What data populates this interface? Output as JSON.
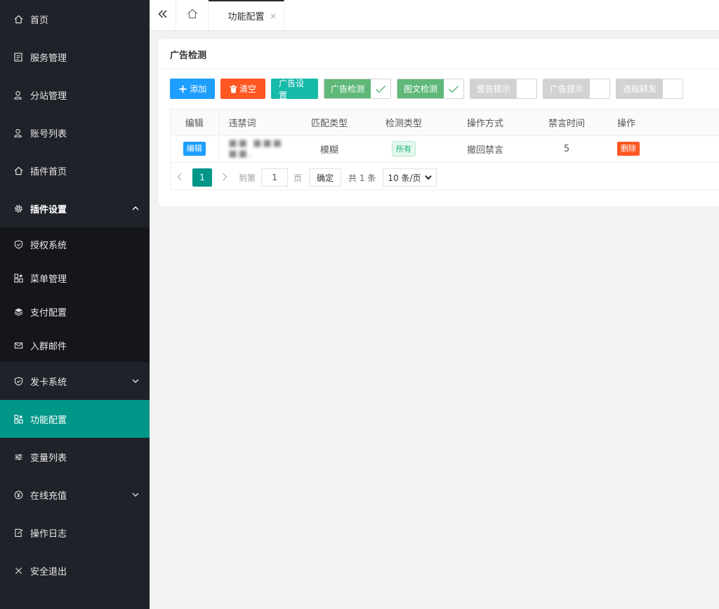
{
  "sidebar": {
    "items": [
      {
        "label": "首页",
        "icon": "home-icon"
      },
      {
        "label": "服务管理",
        "icon": "list-icon"
      },
      {
        "label": "分站管理",
        "icon": "user-icon"
      },
      {
        "label": "账号列表",
        "icon": "user-icon"
      },
      {
        "label": "插件首页",
        "icon": "home-icon"
      },
      {
        "label": "插件设置",
        "icon": "gear-icon"
      },
      {
        "label": "授权系统",
        "icon": "shield-icon"
      },
      {
        "label": "菜单管理",
        "icon": "grid-icon"
      },
      {
        "label": "支付配置",
        "icon": "layers-icon"
      },
      {
        "label": "入群邮件",
        "icon": "mail-icon"
      },
      {
        "label": "发卡系统",
        "icon": "shield-icon"
      },
      {
        "label": "功能配置",
        "icon": "grid-icon"
      },
      {
        "label": "变量列表",
        "icon": "sliders-icon"
      },
      {
        "label": "在线充值",
        "icon": "yen-icon"
      },
      {
        "label": "操作日志",
        "icon": "edit-icon"
      },
      {
        "label": "安全退出",
        "icon": "close-icon"
      }
    ],
    "active_color": "#009688"
  },
  "tabs": {
    "active": {
      "label": "功能配置",
      "close": "×"
    }
  },
  "card": {
    "title": "广告检测"
  },
  "toolbar": {
    "add": "添加",
    "add_symbol": "+",
    "clear": "清空",
    "ad_settings": "广告设置",
    "switches": [
      {
        "label": "广告检测",
        "on": true
      },
      {
        "label": "图文检测",
        "on": true
      },
      {
        "label": "警告提示",
        "on": false
      },
      {
        "label": "广告提示",
        "on": false
      },
      {
        "label": "违规转发",
        "on": false
      }
    ]
  },
  "table": {
    "headers": [
      "编辑",
      "违禁词",
      "匹配类型",
      "检测类型",
      "操作方式",
      "禁言时间",
      "操作"
    ],
    "rows": [
      {
        "edit": "编辑",
        "word": "■■ ■■■ ■■.",
        "match": "模糊",
        "detect": "所有",
        "action": "撤回禁言",
        "mute": "5",
        "op": "删除"
      }
    ]
  },
  "pager": {
    "current": "1",
    "goto": "到第",
    "goto_value": "1",
    "page_unit": "页",
    "confirm": "确定",
    "total": "共 1 条",
    "per_page": "10 条/页"
  },
  "colors": {
    "blue": "#1e9fff",
    "red": "#ff5722",
    "teal": "#16baaa",
    "green": "#5fb878",
    "primary": "#009688"
  }
}
